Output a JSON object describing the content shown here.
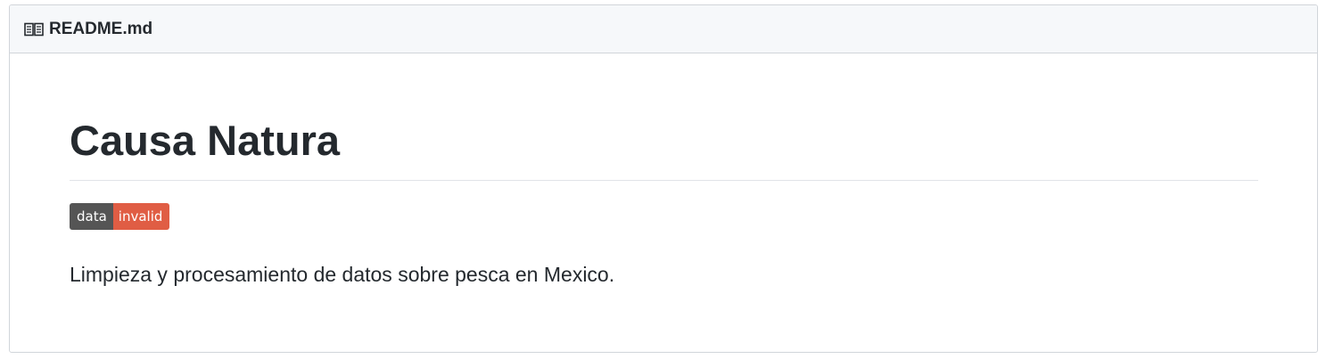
{
  "header": {
    "icon": "book-icon",
    "file_name": "README.md"
  },
  "content": {
    "title": "Causa Natura",
    "badge": {
      "label": "data",
      "status": "invalid",
      "label_color": "#555555",
      "status_color": "#e05d44"
    },
    "description": "Limpieza y procesamiento de datos sobre pesca en Mexico."
  }
}
